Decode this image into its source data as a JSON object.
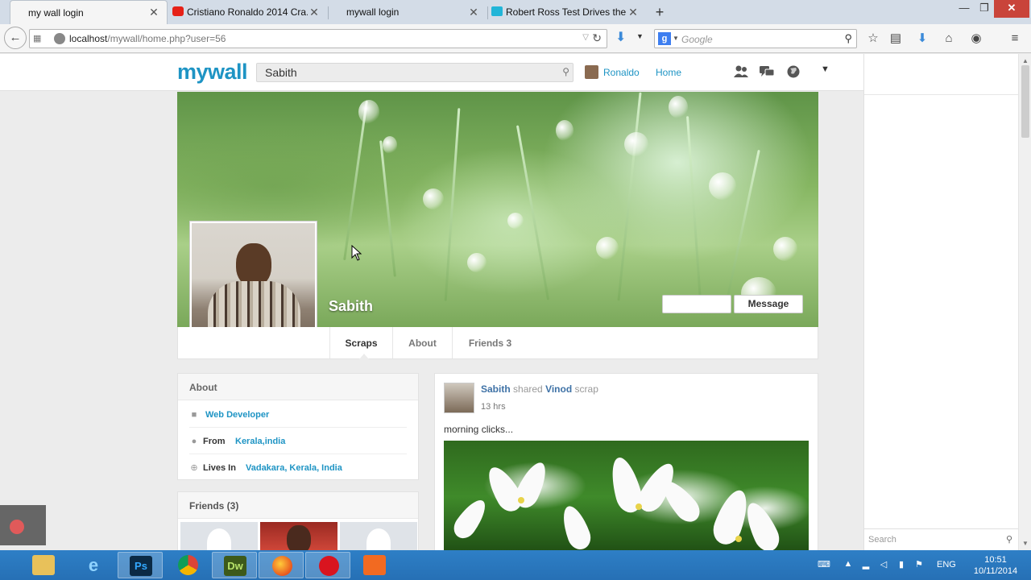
{
  "browser": {
    "tabs": [
      {
        "title": "my wall login",
        "active": true
      },
      {
        "title": "Cristiano Ronaldo 2014 Cra...",
        "active": false
      },
      {
        "title": "mywall login",
        "active": false
      },
      {
        "title": "Robert Ross Test Drives the...",
        "active": false
      }
    ],
    "url_host": "localhost",
    "url_path": "/mywall/home.php?user=56",
    "search_engine_placeholder": "Google"
  },
  "site": {
    "logo": "mywall",
    "search_value": "Sabith",
    "current_user": "Ronaldo",
    "home_label": "Home"
  },
  "profile": {
    "name": "Sabith",
    "message_button": "Message",
    "tabs": [
      "Scraps",
      "About",
      "Friends 3"
    ],
    "active_tab": "Scraps"
  },
  "about": {
    "title": "About",
    "job": "Web Developer",
    "from_label": "From",
    "from_value": "Kerala,india",
    "lives_label": "Lives In",
    "lives_value": "Vadakara, Kerala, India"
  },
  "friends": {
    "title": "Friends (3)"
  },
  "post": {
    "author": "Sabith",
    "action": "shared",
    "target": "Vinod",
    "object": "scrap",
    "time": "13 hrs",
    "text": "morning clicks..."
  },
  "rail": {
    "search_placeholder": "Search"
  },
  "taskbar": {
    "apps": [
      "file-explorer",
      "internet-explorer",
      "photoshop",
      "chrome",
      "dreamweaver",
      "firefox",
      "opera",
      "app"
    ],
    "photoshop_label": "Ps",
    "dreamweaver_label": "Dw",
    "lang": "ENG",
    "time": "10:51",
    "date": "10/11/2014"
  },
  "colors": {
    "brand": "#1e94c4",
    "link": "#3f72a6",
    "taskbar": "#2670b5",
    "close_button": "#c9443a"
  }
}
